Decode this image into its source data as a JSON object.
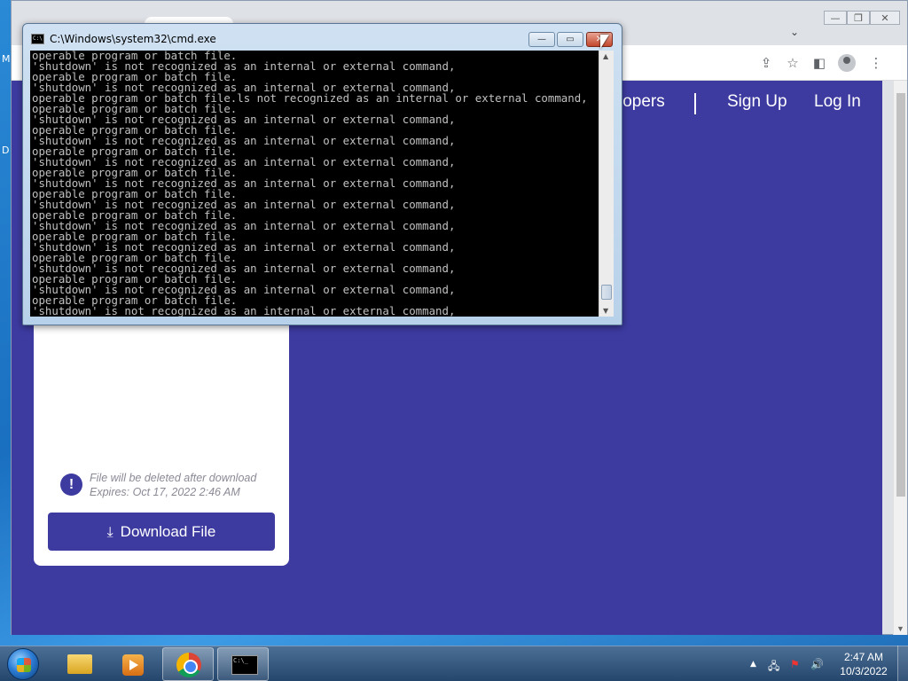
{
  "desktop": {
    "edge_glyph_top": "M",
    "edge_glyph_mid": "D"
  },
  "chrome": {
    "min_glyph": "—",
    "max_glyph": "❐",
    "close_glyph": "✕",
    "tab_dropdown": "⌄",
    "toolbar_icons": {
      "share": "⇪",
      "star": "☆",
      "sidepanel": "◧",
      "menu": "⋮"
    }
  },
  "site": {
    "nav": {
      "developers_partial": "lopers",
      "sign_up": "Sign Up",
      "log_in": "Log In"
    },
    "card": {
      "info_glyph": "!",
      "note_delete": "File will be deleted after download",
      "note_expires": "Expires: Oct 17, 2022 2:46 AM",
      "download_label": "Download File",
      "download_glyph": "⤓"
    }
  },
  "cmd": {
    "title": "C:\\Windows\\system32\\cmd.exe",
    "icon_text": "C:\\",
    "min_glyph": "—",
    "max_glyph": "▭",
    "close_glyph": "✕",
    "lines": [
      "operable program or batch file.",
      "'shutdown' is not recognized as an internal or external command,",
      "operable program or batch file.",
      "'shutdown' is not recognized as an internal or external command,",
      "operable program or batch file.ls not recognized as an internal or external command,",
      "operable program or batch file.",
      "'shutdown' is not recognized as an internal or external command,",
      "operable program or batch file.",
      "'shutdown' is not recognized as an internal or external command,",
      "operable program or batch file.",
      "'shutdown' is not recognized as an internal or external command,",
      "operable program or batch file.",
      "'shutdown' is not recognized as an internal or external command,",
      "operable program or batch file.",
      "'shutdown' is not recognized as an internal or external command,",
      "operable program or batch file.",
      "'shutdown' is not recognized as an internal or external command,",
      "operable program or batch file.",
      "'shutdown' is not recognized as an internal or external command,",
      "operable program or batch file.",
      "'shutdown' is not recognized as an internal or external command,",
      "operable program or batch file.",
      "'shutdown' is not recognized as an internal or external command,",
      "operable program or batch file.",
      "'shutdown' is not recognized as an internal or external command,",
      "operable program or batch file."
    ]
  },
  "taskbar": {
    "cmd_icon_text": "C:\\_",
    "tray": {
      "arrow": "▲",
      "network": "🖧",
      "flag": "⚑",
      "volume": "🔊"
    },
    "clock_time": "2:47 AM",
    "clock_date": "10/3/2022"
  }
}
